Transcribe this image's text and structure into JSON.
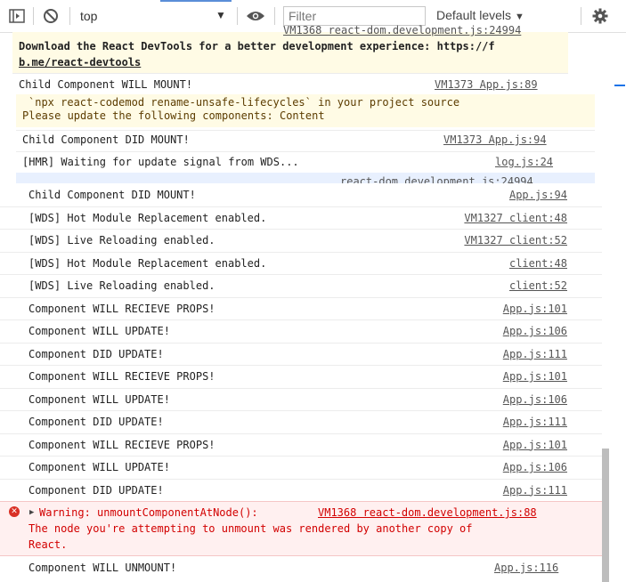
{
  "toolbar": {
    "context": "top",
    "filter_placeholder": "Filter",
    "levels_label": "Default levels"
  },
  "front_panel": {
    "header_cut": "VM1368 react-dom.development.js:24994",
    "devtools_line1": "Download the React DevTools for a better development experience: https://f",
    "devtools_line2": "b.me/react-devtools",
    "child_will_mount": {
      "msg": "Child Component WILL MOUNT!",
      "src": "VM1373 App.js:89"
    }
  },
  "middle_panel": {
    "warn_line1": "`npx react-codemod rename-unsafe-lifecycles` in your project source",
    "warn_line2": "Please update the following components: Content",
    "child_did_mount": {
      "msg": "Child Component DID MOUNT!",
      "src": "VM1373 App.js:94"
    },
    "hmr": {
      "msg": "[HMR] Waiting for update signal from WDS...",
      "src": "log.js:24"
    },
    "cut_src": "react-dom.development.js:24994"
  },
  "rows": [
    {
      "msg": "Child Component DID MOUNT!",
      "src": "App.js:94"
    },
    {
      "msg": "[WDS] Hot Module Replacement enabled.",
      "src": "VM1327 client:48"
    },
    {
      "msg": "[WDS] Live Reloading enabled.",
      "src": "VM1327 client:52"
    },
    {
      "msg": "[WDS] Hot Module Replacement enabled.",
      "src": "client:48"
    },
    {
      "msg": "[WDS] Live Reloading enabled.",
      "src": "client:52"
    },
    {
      "msg": "Component WILL RECIEVE PROPS!",
      "src": "App.js:101"
    },
    {
      "msg": "Component WILL UPDATE!",
      "src": "App.js:106"
    },
    {
      "msg": "Component DID UPDATE!",
      "src": "App.js:111"
    },
    {
      "msg": "Component WILL RECIEVE PROPS!",
      "src": "App.js:101"
    },
    {
      "msg": "Component WILL UPDATE!",
      "src": "App.js:106"
    },
    {
      "msg": "Component DID UPDATE!",
      "src": "App.js:111"
    },
    {
      "msg": "Component WILL RECIEVE PROPS!",
      "src": "App.js:101"
    },
    {
      "msg": "Component WILL UPDATE!",
      "src": "App.js:106"
    },
    {
      "msg": "Component DID UPDATE!",
      "src": "App.js:111"
    }
  ],
  "error": {
    "line1": "Warning: unmountComponentAtNode():",
    "src": "VM1368 react-dom.development.js:88",
    "line2": "The node you're attempting to unmount was rendered by another copy of",
    "line3": "React."
  },
  "last_row": {
    "msg": "Component WILL UNMOUNT!",
    "src": "App.js:116"
  },
  "colors": {
    "warn_bg": "#fffbe5",
    "warn_text": "#5c3c00",
    "error_bg": "#fff0f0",
    "error_text": "#d20000",
    "blue_bg": "#e8f0fe"
  }
}
